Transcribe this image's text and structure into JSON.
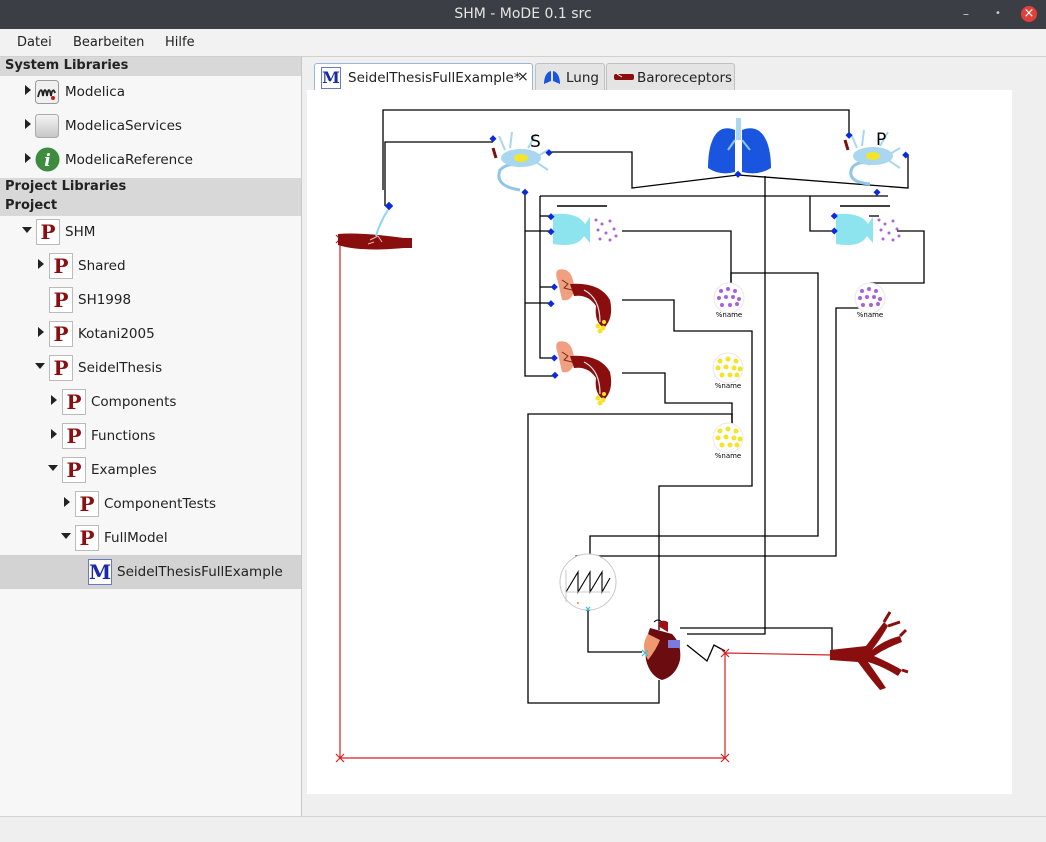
{
  "window": {
    "title": "SHM - MoDE 0.1 src",
    "minimize": "–",
    "maximize": "•",
    "close": "×"
  },
  "menu": {
    "file": "Datei",
    "edit": "Bearbeiten",
    "help": "Hilfe"
  },
  "tree": {
    "system_header": "System Libraries",
    "system": [
      {
        "label": "Modelica",
        "icon": "modelica-logo-icon"
      },
      {
        "label": "ModelicaServices",
        "icon": "gray-box-icon"
      },
      {
        "label": "ModelicaReference",
        "icon": "info-icon"
      }
    ],
    "project_libraries_header": "Project Libraries",
    "project_header": "Project",
    "project": {
      "shm": "SHM",
      "shared": "Shared",
      "sh1998": "SH1998",
      "kotani": "Kotani2005",
      "seidel": "SeidelThesis",
      "components": "Components",
      "functions": "Functions",
      "examples": "Examples",
      "componenttests": "ComponentTests",
      "fullmodel": "FullModel",
      "fullexample": "SeidelThesisFullExample"
    },
    "package_glyph": "P",
    "model_glyph": "M"
  },
  "tabs": [
    {
      "label": "SeidelThesisFullExample*",
      "icon": "model-icon",
      "close": "×",
      "active": true
    },
    {
      "label": "Lung",
      "icon": "lung-icon",
      "active": false
    },
    {
      "label": "Baroreceptors",
      "icon": "vessel-icon",
      "active": false
    }
  ],
  "diagram": {
    "labels": {
      "s": "S",
      "p": "P",
      "name": "%name"
    },
    "colors": {
      "wire": "#000000",
      "red_wire": "#d42020",
      "neuron": "#a9d7ef",
      "lung": "#1a55e0",
      "blood": "#8a0e0e"
    }
  }
}
